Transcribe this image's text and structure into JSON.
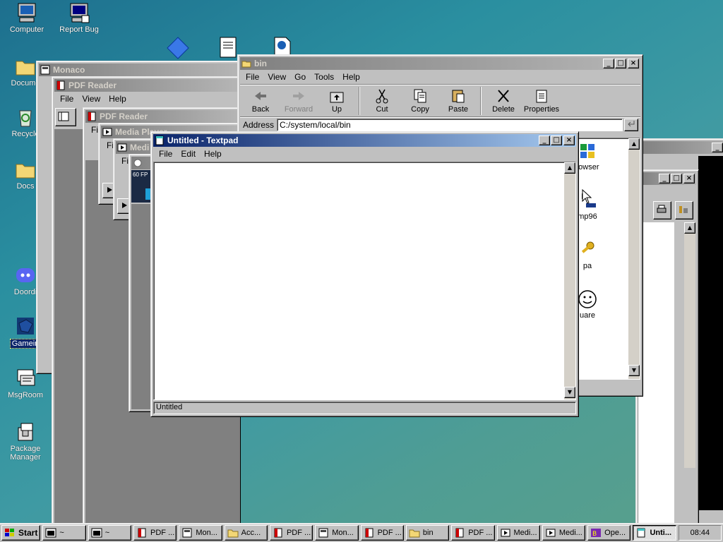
{
  "desktop": {
    "icons": [
      {
        "label": "Computer",
        "icon": "computer-icon"
      },
      {
        "label": "Report Bug",
        "icon": "report-bug-icon"
      },
      {
        "label": "Docume",
        "icon": "folder-icon"
      },
      {
        "label": "Recycle",
        "icon": "recycle-bin-icon"
      },
      {
        "label": "Docs",
        "icon": "folder-icon"
      },
      {
        "label": "Doordi",
        "icon": "discord-icon"
      },
      {
        "label": "Gamein",
        "icon": "gamepad-icon"
      },
      {
        "label": "MsgRoom",
        "icon": "chat-icon"
      },
      {
        "label": "Package Manager",
        "icon": "package-icon"
      }
    ]
  },
  "windows": {
    "monaco": {
      "title": "Monaco"
    },
    "pdf1": {
      "title": "PDF Reader",
      "menu": [
        "File",
        "View",
        "Help"
      ]
    },
    "pdf2": {
      "title": "PDF Reader",
      "menu_partial": "File"
    },
    "media1": {
      "title": "Media Player",
      "menu_partial": "File"
    },
    "media2": {
      "title": "Medi",
      "menu_partial": "File",
      "fps_label": "60 FP"
    },
    "bin": {
      "title": "bin",
      "menu": [
        "File",
        "View",
        "Go",
        "Tools",
        "Help"
      ],
      "toolbar": [
        {
          "label": "Back",
          "icon": "back-arrow-icon"
        },
        {
          "label": "Forward",
          "icon": "forward-arrow-icon"
        },
        {
          "label": "Up",
          "icon": "up-folder-icon"
        },
        {
          "label": "Cut",
          "icon": "scissors-icon"
        },
        {
          "label": "Copy",
          "icon": "copy-icon"
        },
        {
          "label": "Paste",
          "icon": "paste-icon"
        },
        {
          "label": "Delete",
          "icon": "delete-x-icon"
        },
        {
          "label": "Properties",
          "icon": "properties-icon"
        }
      ],
      "address_label": "Address",
      "address_value": "C:/system/local/bin",
      "files": [
        {
          "label": "rowser",
          "icon": "windows-logo-icon"
        },
        {
          "label": "mp96",
          "icon": "winamp-icon"
        },
        {
          "label": "pa",
          "icon": "key-icon"
        },
        {
          "label": "uare",
          "icon": "smiley-icon"
        }
      ]
    },
    "textpad": {
      "title": "Untitled - Textpad",
      "menu": [
        "File",
        "Edit",
        "Help"
      ],
      "content": "",
      "status": "Untitled"
    }
  },
  "taskbar": {
    "start_label": "Start",
    "buttons": [
      {
        "label": "~",
        "icon": "terminal-icon"
      },
      {
        "label": "~",
        "icon": "terminal-icon"
      },
      {
        "label": "PDF ...",
        "icon": "pdf-icon"
      },
      {
        "label": "Mon...",
        "icon": "monaco-icon"
      },
      {
        "label": "Acc...",
        "icon": "folder-icon"
      },
      {
        "label": "PDF ...",
        "icon": "pdf-icon"
      },
      {
        "label": "Mon...",
        "icon": "monaco-icon"
      },
      {
        "label": "PDF ...",
        "icon": "pdf-icon"
      },
      {
        "label": "bin",
        "icon": "folder-icon"
      },
      {
        "label": "PDF ...",
        "icon": "pdf-icon"
      },
      {
        "label": "Medi...",
        "icon": "media-player-icon"
      },
      {
        "label": "Medi...",
        "icon": "media-player-icon"
      },
      {
        "label": "Ope...",
        "icon": "opera-icon"
      },
      {
        "label": "Unti...",
        "icon": "textpad-icon"
      }
    ],
    "clock": "08:44"
  }
}
